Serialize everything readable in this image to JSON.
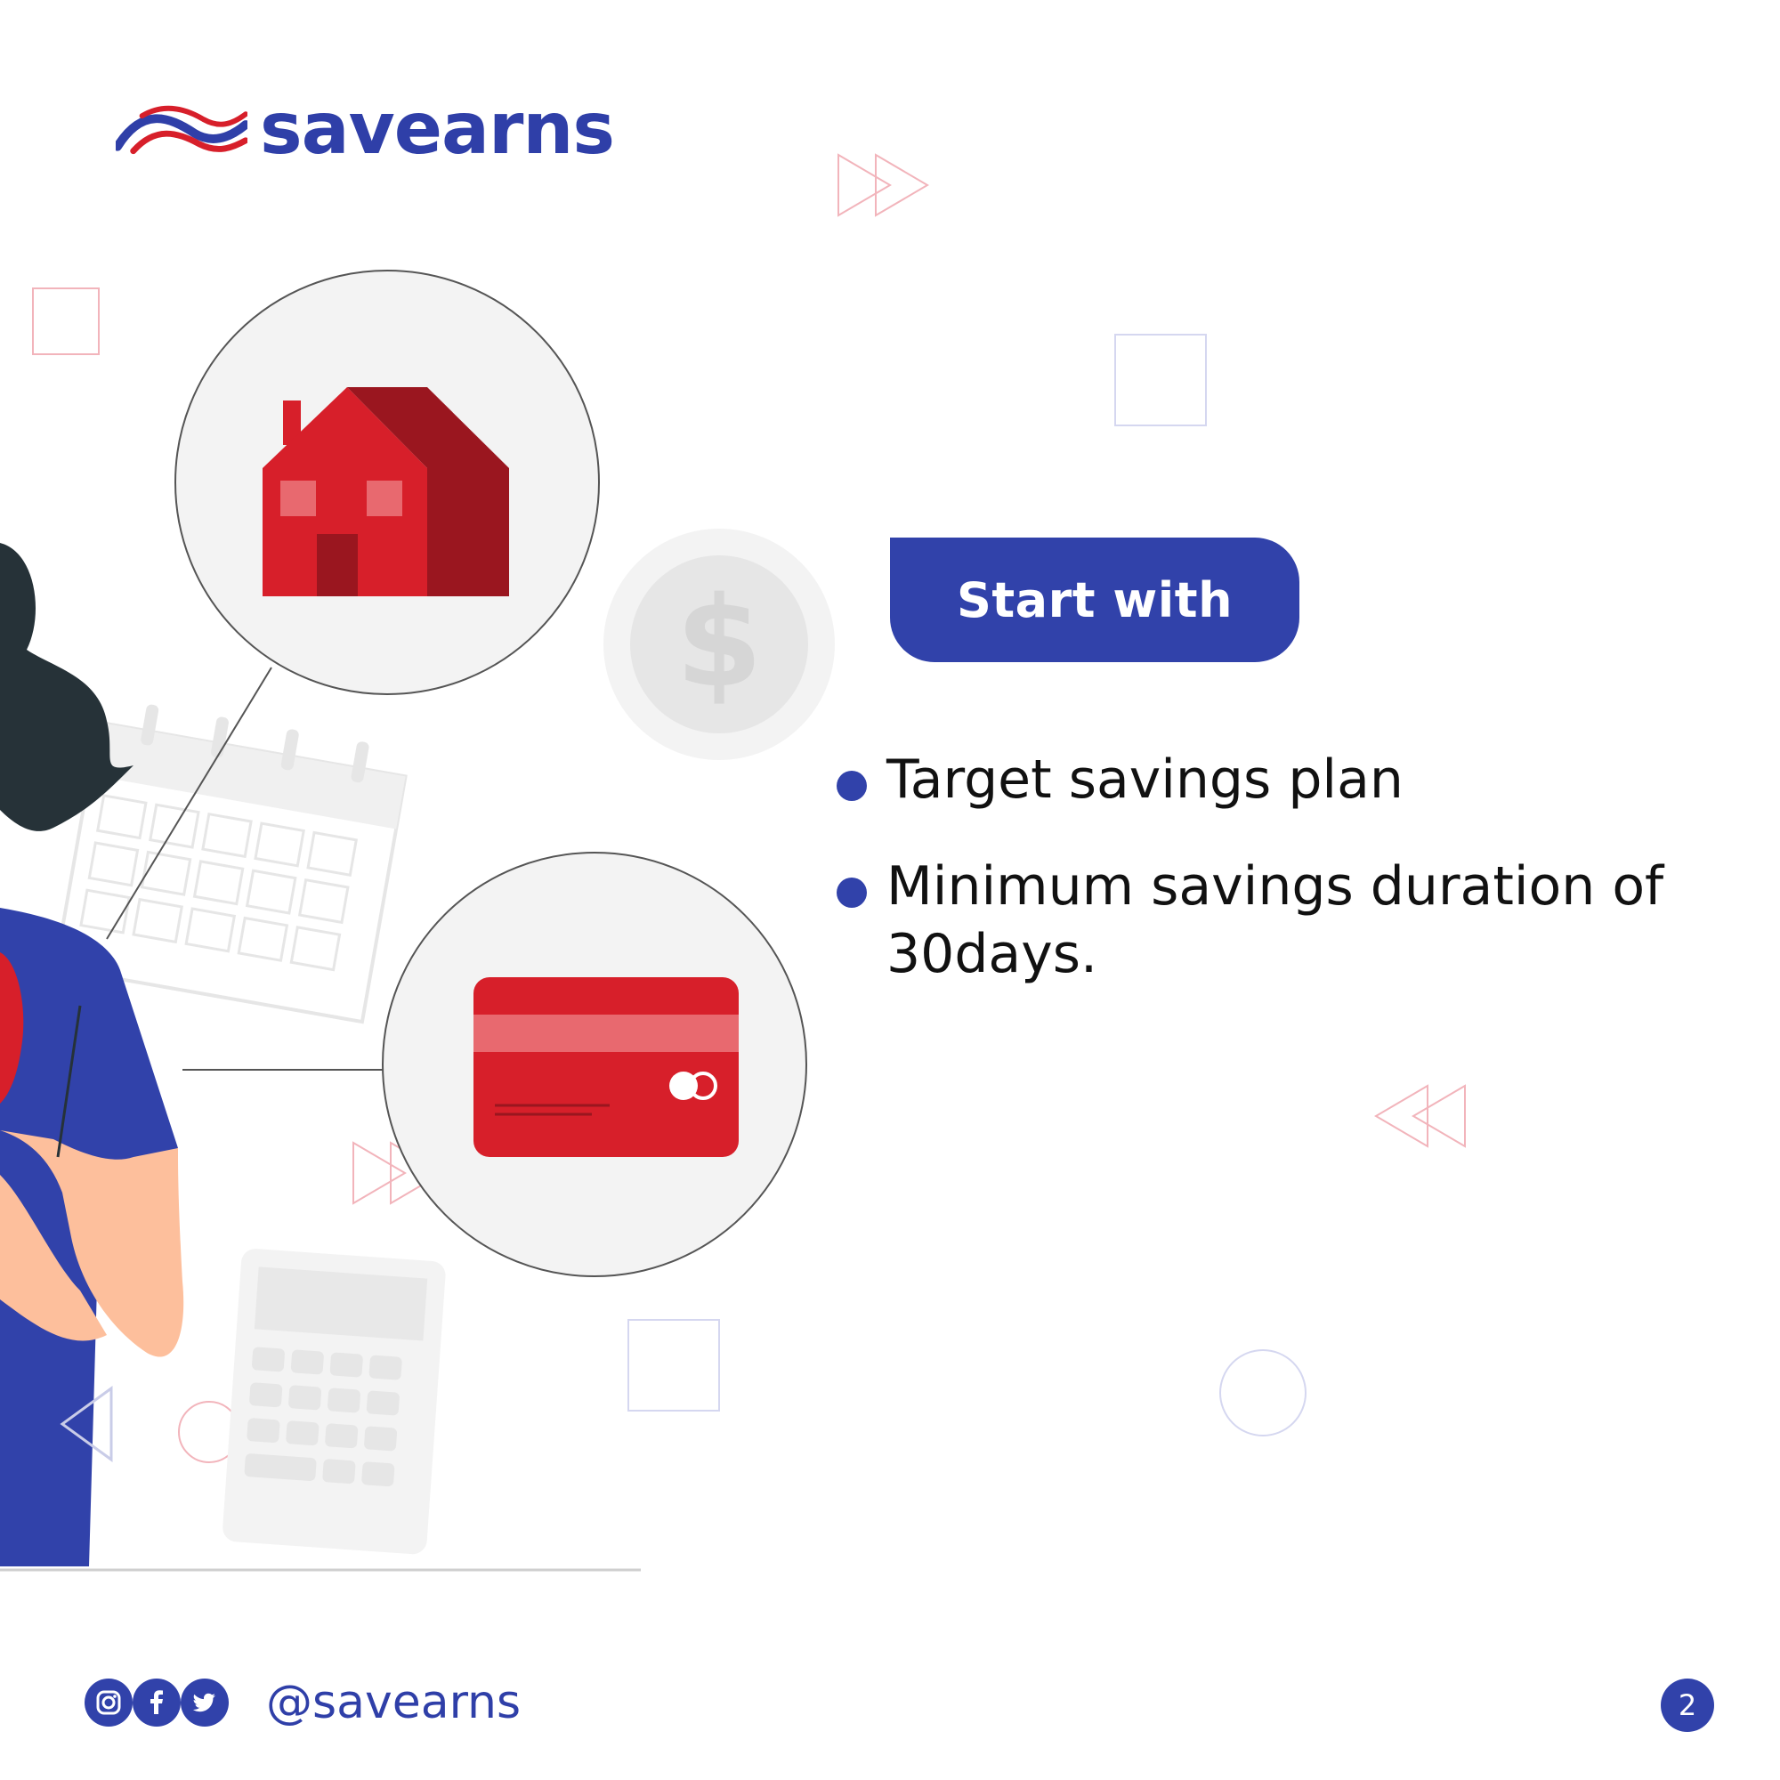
{
  "brand": {
    "name": "savearns",
    "colors": {
      "primary_blue": "#3142aa",
      "accent_red": "#d71f2a",
      "dark_red": "#9a161f",
      "skin": "#fdbf9c",
      "hair": "#263238",
      "light_gray": "#f3f3f3"
    }
  },
  "header": {
    "logo_text": "savearns",
    "logo_icon": "waves-logo-icon"
  },
  "main": {
    "pill_label": "Start with",
    "bullets": [
      "Target savings plan",
      "Minimum savings duration of 30days."
    ]
  },
  "illustration": {
    "icons": [
      "house-icon",
      "credit-card-icon",
      "dollar-coin-icon",
      "calendar-icon",
      "calculator-icon",
      "woman-figure"
    ]
  },
  "footer": {
    "social_icons": [
      "instagram-icon",
      "facebook-icon",
      "twitter-icon"
    ],
    "handle": "@savearns",
    "page_number": "2"
  }
}
